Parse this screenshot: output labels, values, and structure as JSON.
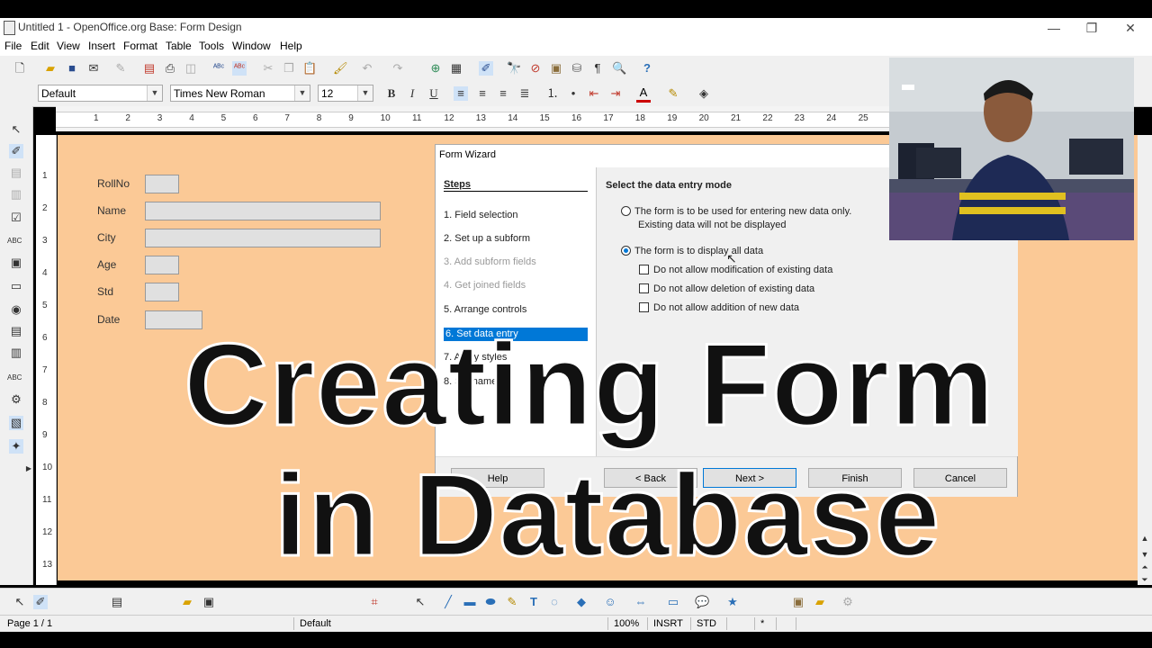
{
  "window": {
    "title": "Untitled 1 - OpenOffice.org Base: Form Design",
    "minimize": "—",
    "restore": "❐",
    "close": "✕"
  },
  "menu": [
    "File",
    "Edit",
    "View",
    "Insert",
    "Format",
    "Table",
    "Tools",
    "Window",
    "Help"
  ],
  "formatting": {
    "style": "Default",
    "font": "Times New Roman",
    "size": "12"
  },
  "ruler": {
    "h": [
      "1",
      "2",
      "3",
      "4",
      "5",
      "6",
      "7",
      "8",
      "9",
      "10",
      "11",
      "12",
      "13",
      "14",
      "15",
      "16",
      "17",
      "18",
      "19",
      "20",
      "21",
      "22",
      "23",
      "24",
      "25"
    ],
    "v": [
      "1",
      "2",
      "3",
      "4",
      "5",
      "6",
      "7",
      "8",
      "9",
      "10",
      "11",
      "12",
      "13"
    ]
  },
  "form": {
    "fields": [
      {
        "label": "RollNo"
      },
      {
        "label": "Name"
      },
      {
        "label": "City"
      },
      {
        "label": "Age"
      },
      {
        "label": "Std"
      },
      {
        "label": "Date"
      }
    ]
  },
  "wizard": {
    "title": "Form Wizard",
    "steps_header": "Steps",
    "steps": [
      {
        "label": "1. Field selection",
        "state": "normal"
      },
      {
        "label": "2. Set up a subform",
        "state": "normal"
      },
      {
        "label": "3. Add subform fields",
        "state": "disabled"
      },
      {
        "label": "4. Get joined fields",
        "state": "disabled"
      },
      {
        "label": "5. Arrange controls",
        "state": "normal"
      },
      {
        "label": "6. Set data entry",
        "state": "selected"
      },
      {
        "label": "7. Apply styles",
        "state": "normal"
      },
      {
        "label": "8. Set name",
        "state": "normal"
      }
    ],
    "heading": "Select the data entry mode",
    "radio1_line1": "The form is to be used for entering new data only.",
    "radio1_line2": "Existing data will not be displayed",
    "radio2": "The form is to display all data",
    "check1": "Do not allow modification of existing data",
    "check2": "Do not allow deletion of existing data",
    "check3": "Do not allow addition of new data",
    "buttons": {
      "help": "Help",
      "back": "< Back",
      "next": "Next >",
      "finish": "Finish",
      "cancel": "Cancel"
    }
  },
  "status": {
    "page": "Page 1 / 1",
    "style": "Default",
    "zoom": "100%",
    "insert": "INSRT",
    "std": "STD",
    "star": "*"
  },
  "overlay": {
    "line1": "Creating Form",
    "line2": "in Database"
  },
  "colors": {
    "canvas": "#fbc996",
    "accent": "#0078d7"
  }
}
